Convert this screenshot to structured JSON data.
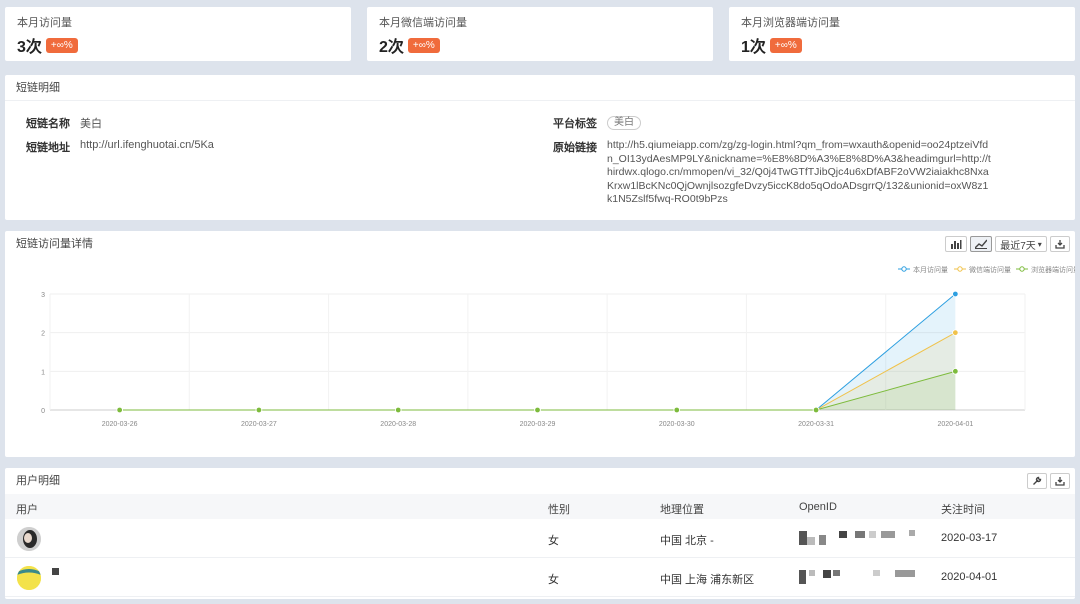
{
  "stats": [
    {
      "label": "本月访问量",
      "value": "3次",
      "badge": "+∞%"
    },
    {
      "label": "本月微信端访问量",
      "value": "2次",
      "badge": "+∞%"
    },
    {
      "label": "本月浏览器端访问量",
      "value": "1次",
      "badge": "+∞%"
    }
  ],
  "detail": {
    "title": "短链明细",
    "name_label": "短链名称",
    "name_value": "美白",
    "platform_label": "平台标签",
    "platform_tag": "美白",
    "url_label": "短链地址",
    "url_value": "http://url.ifenghuotai.cn/5Ka",
    "orig_label": "原始链接",
    "orig_value": "http://h5.qiumeiapp.com/zg/zg-login.html?qm_from=wxauth&openid=oo24ptzeiVfdn_OI13ydAesMP9LY&nickname=%E8%8D%A3%E8%8D%A3&headimgurl=http://thirdwx.qlogo.cn/mmopen/vi_32/Q0j4TwGTfTJibQjc4u6xDfABF2oVW2iaiakhc8NxaKrxw1lBcKNc0QjOwnjlsozgfeDvzy5iccK8do5qOdoADsgrrQ/132&unionid=oxW8z1k1N5Zslf5fwq-RO0t9bPzs"
  },
  "chart_section": {
    "title": "短链访问量详情",
    "range_label": "最近7天",
    "range_arrow": "▾"
  },
  "chart_data": {
    "type": "area",
    "categories": [
      "2020-03-26",
      "2020-03-27",
      "2020-03-28",
      "2020-03-29",
      "2020-03-30",
      "2020-03-31",
      "2020-04-01"
    ],
    "series": [
      {
        "name": "本月访问量",
        "values": [
          0,
          0,
          0,
          0,
          0,
          0,
          3
        ],
        "color": "#2d9fe0"
      },
      {
        "name": "微信端访问量",
        "values": [
          0,
          0,
          0,
          0,
          0,
          0,
          2
        ],
        "color": "#f0c24a"
      },
      {
        "name": "浏览器端访问量",
        "values": [
          0,
          0,
          0,
          0,
          0,
          0,
          1
        ],
        "color": "#7dbb3c"
      }
    ],
    "ylim": [
      0,
      3
    ],
    "yticks": [
      "0",
      "1",
      "2",
      "3"
    ],
    "legend": "top-right",
    "grid": true
  },
  "users": {
    "title": "用户明细",
    "columns": [
      "用户",
      "性别",
      "地理位置",
      "OpenID",
      "关注时间"
    ],
    "rows": [
      {
        "gender": "女",
        "location": "中国 北京 -",
        "time": "2020-03-17"
      },
      {
        "gender": "女",
        "location": "中国 上海 浦东新区",
        "time": "2020-04-01"
      }
    ]
  },
  "icons": {
    "bar": "bar-chart-icon",
    "line": "line-chart-icon",
    "download": "download-icon",
    "wrench": "wrench-icon"
  }
}
